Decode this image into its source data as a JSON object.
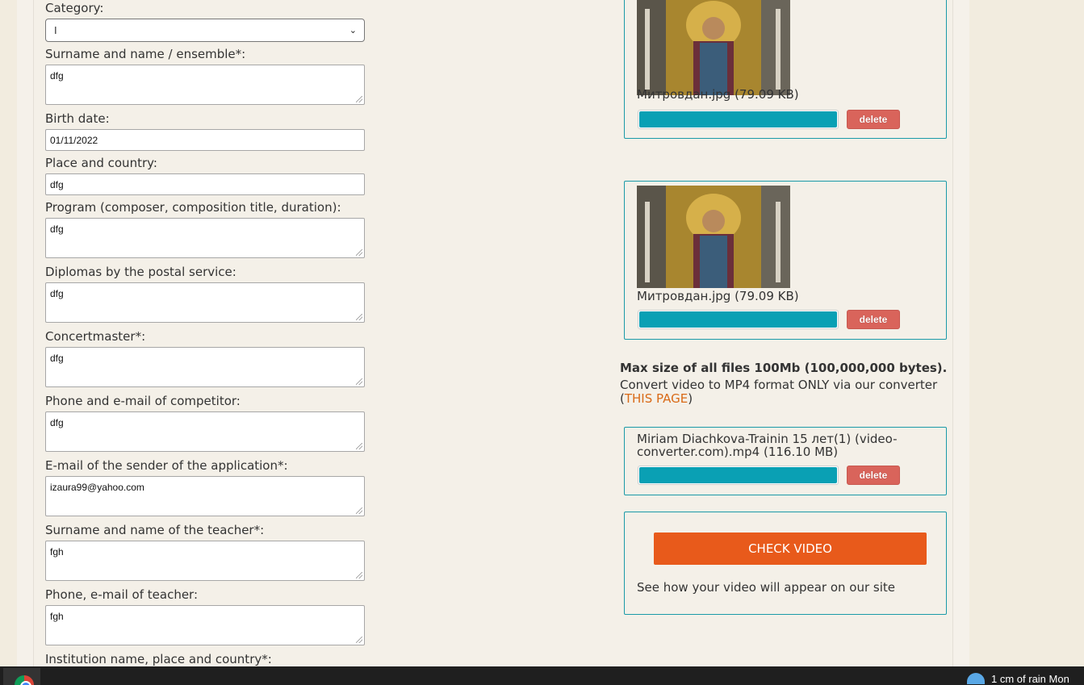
{
  "form": {
    "category": {
      "label": "Category:",
      "value": "I"
    },
    "fields": [
      {
        "label": "Surname and name / ensemble*:",
        "value": "dfg"
      },
      {
        "label": "Birth date:",
        "value": "01/11/2022"
      },
      {
        "label": "Place and country:",
        "value": "dfg"
      },
      {
        "label": "Program (composer, composition title, duration):",
        "value": "dfg"
      },
      {
        "label": "Diplomas by the postal service:",
        "value": "dfg"
      },
      {
        "label": "Concertmaster*:",
        "value": "dfg"
      },
      {
        "label": "Phone and e-mail of competitor:",
        "value": "dfg"
      },
      {
        "label": "E-mail of the sender of the application*:",
        "value": "izaura99@yahoo.com"
      },
      {
        "label": "Surname and name of the teacher*:",
        "value": "fgh"
      },
      {
        "label": "Phone, e-mail of teacher:",
        "value": "fgh"
      },
      {
        "label": "Institution name, place and country*:",
        "value": ""
      }
    ]
  },
  "uploads": [
    {
      "filename": "Митровдан.jpg (79.09 KB)",
      "progress": 1.0,
      "delete_label": "delete"
    },
    {
      "filename": "Митровдан.jpg (79.09 KB)",
      "progress": 1.0,
      "delete_label": "delete"
    }
  ],
  "limits": {
    "max_size": "Max size of all files 100Mb (100,000,000 bytes).",
    "convert_text": "Convert video to MP4 format ONLY via our converter (",
    "convert_link": "THIS PAGE",
    "convert_close": ")"
  },
  "video_upload": {
    "filename": "Miriam Diachkova-Trainin 15 лет(1) (video-converter.com).mp4 (116.10 MB)",
    "progress": 1.0,
    "delete_label": "delete"
  },
  "check_video": {
    "button_label": "CHECK VIDEO",
    "hint": "See how your video will appear on our site"
  },
  "taskbar": {
    "weather": "1 cm of rain Mon"
  }
}
